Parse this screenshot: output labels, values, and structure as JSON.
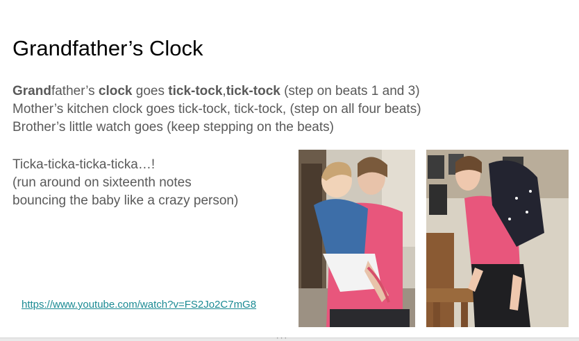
{
  "slide": {
    "title": "Grandfather’s Clock",
    "line1": {
      "part1": "Grand",
      "part2": "father’s ",
      "part3": "clock",
      "part4": " goes ",
      "part5": "tick-tock",
      "part6": ",",
      "part7": "tick-tock",
      "part8": " (step on beats 1 and 3)"
    },
    "line2": "Mother’s kitchen clock goes tick-tock, tick-tock, (step on all four beats)",
    "line3": "Brother’s little watch goes (keep stepping on the beats)",
    "line4": "Ticka-ticka-ticka-ticka…!",
    "line5": "(run around on sixteenth notes",
    "line6": "bouncing the baby like a crazy person)",
    "link": "https://www.youtube.com/watch?v=FS2Jo2C7mG8"
  },
  "colors": {
    "body_text": "#595959",
    "link": "#1a8a93"
  }
}
